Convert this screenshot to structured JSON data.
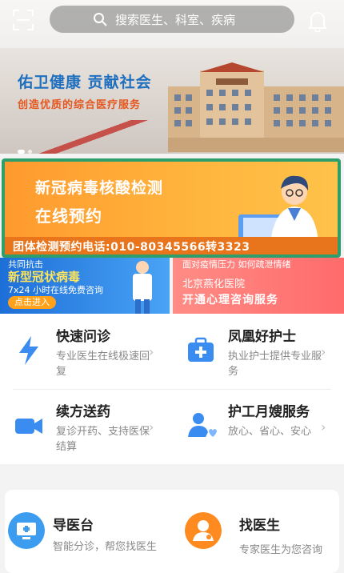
{
  "search": {
    "placeholder": "搜索医生、科室、疾病"
  },
  "hero": {
    "slogan": "佑卫健康  贡献社会",
    "subslogan": "创造优质的综合医疗服务"
  },
  "covid_banner": {
    "title": "新冠病毒核酸检测",
    "subtitle": "在线预约",
    "phone": "团体检测预约电话:010-80345566转3323"
  },
  "banner_left": {
    "line1": "共同抗击",
    "line2": "新型冠状病毒",
    "line3": "7x24 小时在线免费咨询",
    "button": "点击进入"
  },
  "banner_right": {
    "line1": "面对疫情压力 如何疏泄情绪",
    "line2": "北京燕化医院",
    "line3": "开通心理咨询服务"
  },
  "services": [
    {
      "title": "快速问诊",
      "desc": "专业医生在线极速回复",
      "icon": "lightning-icon"
    },
    {
      "title": "凤凰好护士",
      "desc": "执业护士提供专业服务",
      "icon": "medkit-icon"
    },
    {
      "title": "续方送药",
      "desc": "复诊开药、支持医保结算",
      "icon": "video-camera-icon"
    },
    {
      "title": "护工月嫂服务",
      "desc": "放心、省心、安心",
      "icon": "caregiver-icon"
    }
  ],
  "quick": [
    {
      "title": "导医台",
      "desc": "智能分诊，帮您找医生",
      "icon": "monitor-icon"
    },
    {
      "title": "找医生",
      "desc": "专家医生为您咨询",
      "icon": "doctor-icon"
    }
  ],
  "colors": {
    "accent_blue": "#1f6fbf",
    "accent_orange": "#ff8a1f",
    "icon_blue": "#3b8cf0"
  }
}
